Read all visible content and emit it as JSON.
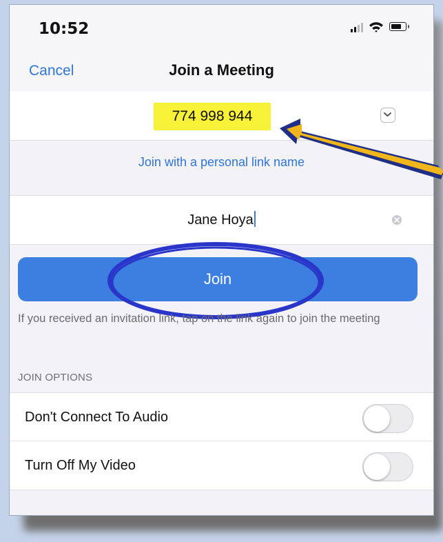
{
  "status_bar": {
    "time": "10:52"
  },
  "nav": {
    "cancel_label": "Cancel",
    "title": "Join a Meeting"
  },
  "meeting": {
    "id": "774 998 944",
    "highlight_color": "#f7f238"
  },
  "personal_link": {
    "label": "Join with a personal link name"
  },
  "name_field": {
    "value": "Jane Hoya"
  },
  "join_button": {
    "label": "Join",
    "color": "#3c7fe0"
  },
  "hint": {
    "text": "If you received an invitation link, tap on the link again to join the meeting"
  },
  "join_options": {
    "section_label": "JOIN OPTIONS",
    "options": [
      {
        "label": "Don't Connect To Audio",
        "enabled": false
      },
      {
        "label": "Turn Off My Video",
        "enabled": false
      }
    ]
  },
  "annotations": {
    "arrow_color": "#f2b51a",
    "ellipse_color": "#2a36c9"
  },
  "icons": [
    "cellular-signal-icon",
    "wifi-icon",
    "battery-icon",
    "chevron-down-icon",
    "clear-icon"
  ]
}
